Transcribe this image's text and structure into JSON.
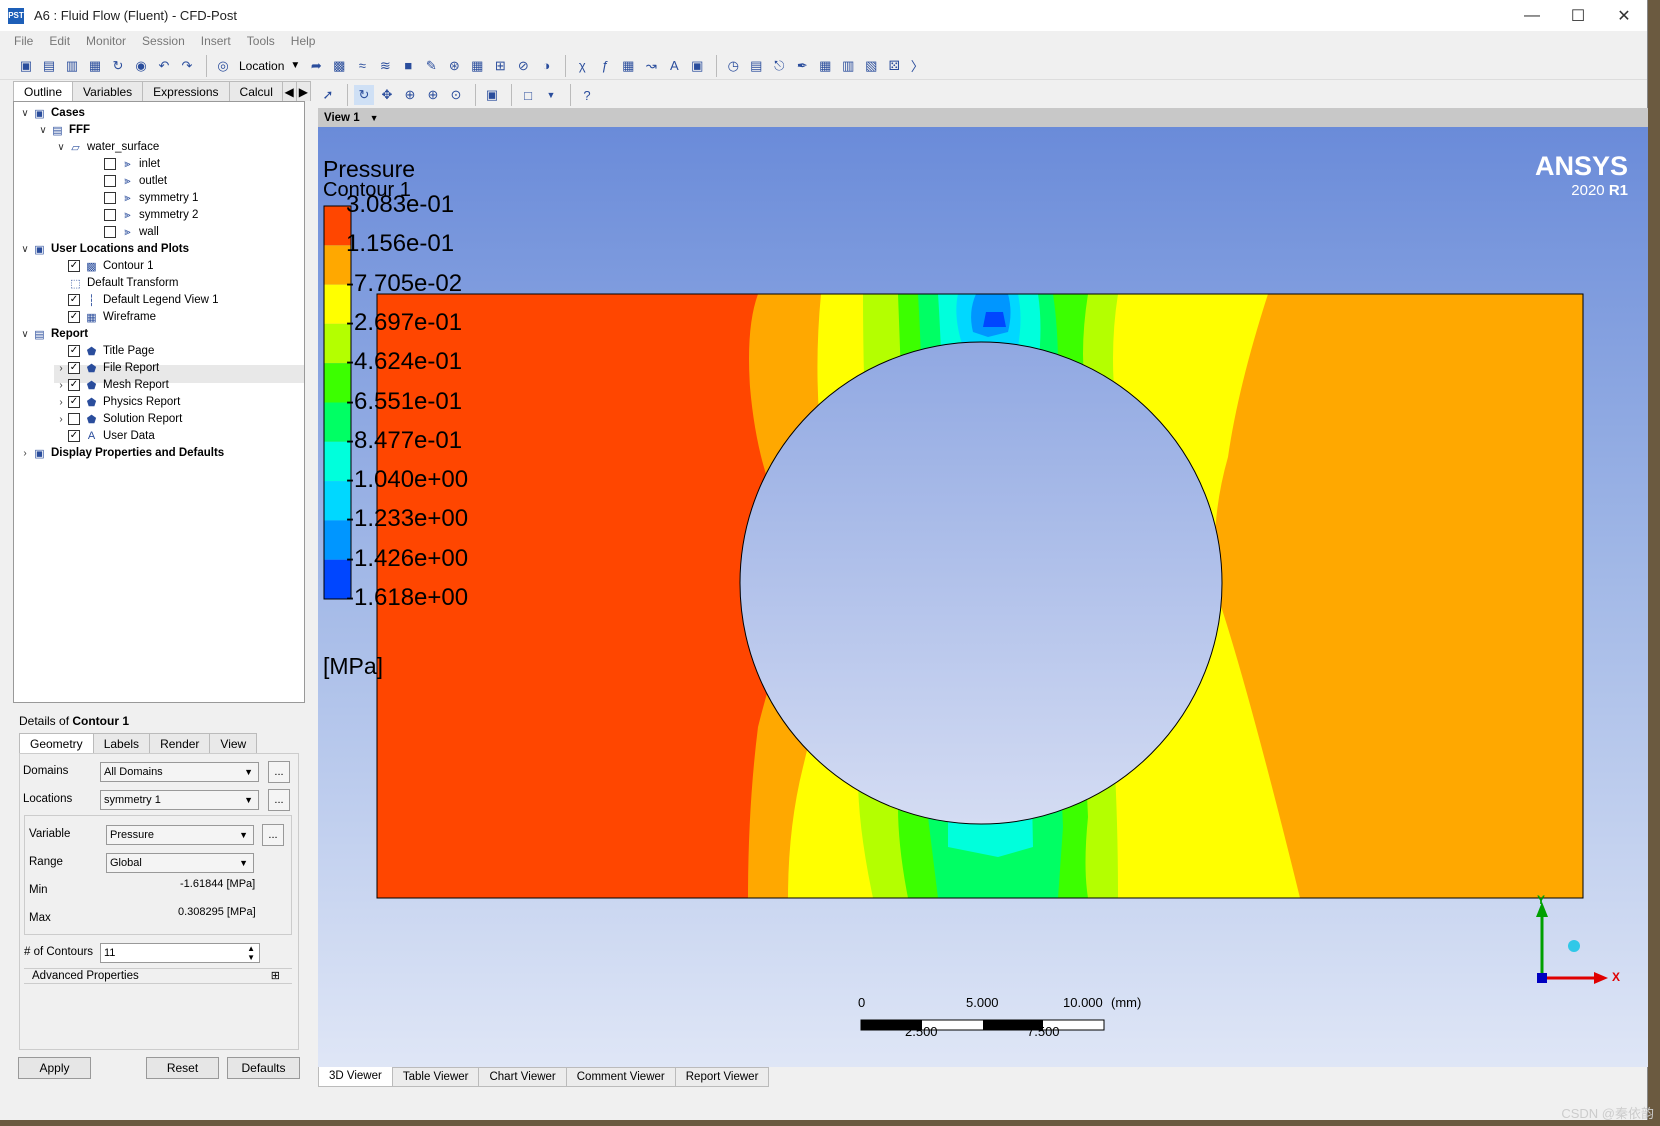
{
  "window": {
    "title": "A6 : Fluid Flow (Fluent) - CFD-Post",
    "app_icon": "PST",
    "min_glyph": "—",
    "max_glyph": "☐",
    "close_glyph": "✕"
  },
  "menu": [
    "File",
    "Edit",
    "Monitor",
    "Session",
    "Insert",
    "Tools",
    "Help"
  ],
  "toolbar": {
    "location_label": "Location"
  },
  "panel_tabs": [
    "Outline",
    "Variables",
    "Expressions",
    "Calcul"
  ],
  "tree": [
    {
      "label": "Cases",
      "level": 0,
      "expander": "∨",
      "bold": true,
      "checkbox": null,
      "icon": "cases-icon"
    },
    {
      "label": "FFF",
      "level": 1,
      "expander": "∨",
      "bold": true,
      "checkbox": null,
      "icon": "fluent-case-icon"
    },
    {
      "label": "water_surface",
      "level": 2,
      "expander": "∨",
      "bold": false,
      "checkbox": null,
      "icon": "domain-icon"
    },
    {
      "label": "inlet",
      "level": 4,
      "expander": "",
      "bold": false,
      "checkbox": false,
      "icon": "boundary-icon"
    },
    {
      "label": "outlet",
      "level": 4,
      "expander": "",
      "bold": false,
      "checkbox": false,
      "icon": "boundary-icon"
    },
    {
      "label": "symmetry 1",
      "level": 4,
      "expander": "",
      "bold": false,
      "checkbox": false,
      "icon": "boundary-icon"
    },
    {
      "label": "symmetry 2",
      "level": 4,
      "expander": "",
      "bold": false,
      "checkbox": false,
      "icon": "boundary-icon"
    },
    {
      "label": "wall",
      "level": 4,
      "expander": "",
      "bold": false,
      "checkbox": false,
      "icon": "boundary-icon"
    },
    {
      "label": "User Locations and Plots",
      "level": 0,
      "expander": "∨",
      "bold": true,
      "checkbox": null,
      "icon": "user-locations-icon"
    },
    {
      "label": "Contour 1",
      "level": 2,
      "expander": "",
      "bold": false,
      "checkbox": true,
      "icon": "contour-icon"
    },
    {
      "label": "Default Transform",
      "level": 2,
      "expander": "",
      "bold": false,
      "checkbox": null,
      "icon": "transform-icon"
    },
    {
      "label": "Default Legend View 1",
      "level": 2,
      "expander": "",
      "bold": false,
      "checkbox": true,
      "icon": "legend-icon"
    },
    {
      "label": "Wireframe",
      "level": 2,
      "expander": "",
      "bold": false,
      "checkbox": true,
      "icon": "wireframe-icon"
    },
    {
      "label": "Report",
      "level": 0,
      "expander": "∨",
      "bold": true,
      "checkbox": null,
      "icon": "report-icon"
    },
    {
      "label": "Title Page",
      "level": 2,
      "expander": "",
      "bold": false,
      "checkbox": true,
      "icon": "report-item-icon"
    },
    {
      "label": "File Report",
      "level": 2,
      "expander": "›",
      "bold": false,
      "checkbox": true,
      "icon": "report-item-icon"
    },
    {
      "label": "Mesh Report",
      "level": 2,
      "expander": "›",
      "bold": false,
      "checkbox": true,
      "icon": "report-item-icon"
    },
    {
      "label": "Physics Report",
      "level": 2,
      "expander": "›",
      "bold": false,
      "checkbox": true,
      "icon": "report-item-icon"
    },
    {
      "label": "Solution Report",
      "level": 2,
      "expander": "›",
      "bold": false,
      "checkbox": false,
      "icon": "report-item-icon"
    },
    {
      "label": "User Data",
      "level": 2,
      "expander": "",
      "bold": false,
      "checkbox": true,
      "icon": "text-icon"
    },
    {
      "label": "Display Properties and Defaults",
      "level": 0,
      "expander": "›",
      "bold": true,
      "checkbox": null,
      "icon": "display-props-icon"
    }
  ],
  "details": {
    "prefix": "Details of ",
    "name": "Contour 1",
    "tabs": [
      "Geometry",
      "Labels",
      "Render",
      "View"
    ],
    "domains_label": "Domains",
    "domains_value": "All Domains",
    "locations_label": "Locations",
    "locations_value": "symmetry 1",
    "variable_label": "Variable",
    "variable_value": "Pressure",
    "range_label": "Range",
    "range_value": "Global",
    "min_label": "Min",
    "min_value": "-1.61844 [MPa]",
    "max_label": "Max",
    "max_value": "0.308295 [MPa]",
    "contours_label": "# of Contours",
    "contours_value": "11",
    "advanced_label": "Advanced Properties",
    "ellipsis": "...",
    "apply": "Apply",
    "reset": "Reset",
    "defaults": "Defaults"
  },
  "viewer": {
    "view_label": "View 1",
    "legend_title": "Pressure",
    "legend_subtitle": "Contour 1",
    "legend_unit": "[MPa]",
    "legend_ticks": [
      "3.083e-01",
      "1.156e-01",
      "-7.705e-02",
      "-2.697e-01",
      "-4.624e-01",
      "-6.551e-01",
      "-8.477e-01",
      "-1.040e+00",
      "-1.233e+00",
      "-1.426e+00",
      "-1.618e+00"
    ],
    "legend_colors": [
      "#ff4600",
      "#ffa800",
      "#ffff00",
      "#b4ff00",
      "#3cff00",
      "#00ff64",
      "#00ffdc",
      "#00d8ff",
      "#0096ff",
      "#0046ff"
    ],
    "brand": "ANSYS",
    "version_year": "2020",
    "version_rel": "R1",
    "scale_top": [
      "0",
      "5.000",
      "10.000",
      "(mm)"
    ],
    "scale_bottom": [
      "2.500",
      "7.500"
    ],
    "axis_x": "X",
    "axis_y": "Y"
  },
  "bottom_tabs": [
    "3D Viewer",
    "Table Viewer",
    "Chart Viewer",
    "Comment Viewer",
    "Report Viewer"
  ],
  "watermark": "CSDN @秦依韵"
}
